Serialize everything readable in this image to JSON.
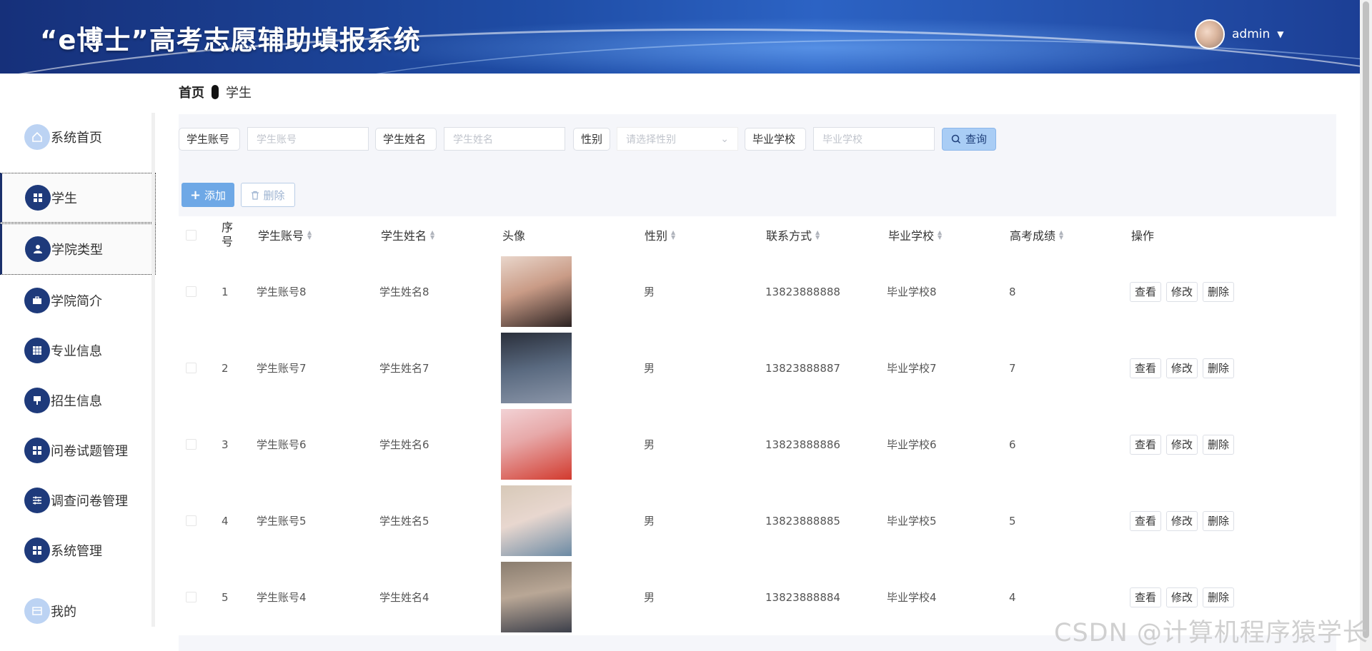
{
  "header": {
    "title": "“e博士”高考志愿辅助填报系统",
    "username": "admin"
  },
  "breadcrumb": {
    "home": "首页",
    "current": "学生"
  },
  "sidebar": {
    "items": [
      {
        "label": "系统首页",
        "icon": "home-icon",
        "active": false
      },
      {
        "label": "学生",
        "icon": "grid-icon",
        "active": true
      },
      {
        "label": "学院类型",
        "icon": "user-icon",
        "active": true
      },
      {
        "label": "学院简介",
        "icon": "briefcase-icon",
        "active": false
      },
      {
        "label": "专业信息",
        "icon": "grid-icon",
        "active": false
      },
      {
        "label": "招生信息",
        "icon": "flag-icon",
        "active": false
      },
      {
        "label": "问卷试题管理",
        "icon": "grid-icon",
        "active": false
      },
      {
        "label": "调查问卷管理",
        "icon": "sliders-icon",
        "active": false
      },
      {
        "label": "系统管理",
        "icon": "grid-icon",
        "active": false
      },
      {
        "label": "我的",
        "icon": "card-icon",
        "active": false
      }
    ]
  },
  "search": {
    "account_label": "学生账号",
    "account_placeholder": "学生账号",
    "name_label": "学生姓名",
    "name_placeholder": "学生姓名",
    "gender_label": "性别",
    "gender_placeholder": "请选择性别",
    "school_label": "毕业学校",
    "school_placeholder": "毕业学校",
    "query_label": "查询"
  },
  "actions": {
    "add_label": "添加",
    "delete_label": "删除"
  },
  "table": {
    "headers": {
      "index": "序号",
      "account": "学生账号",
      "name": "学生姓名",
      "avatar": "头像",
      "gender": "性别",
      "phone": "联系方式",
      "school": "毕业学校",
      "score": "高考成绩",
      "ops": "操作"
    },
    "op_labels": {
      "view": "查看",
      "edit": "修改",
      "delete": "删除"
    },
    "rows": [
      {
        "index": "1",
        "account": "学生账号8",
        "name": "学生姓名8",
        "gender": "男",
        "phone": "13823888888",
        "school": "毕业学校8",
        "score": "8"
      },
      {
        "index": "2",
        "account": "学生账号7",
        "name": "学生姓名7",
        "gender": "男",
        "phone": "13823888887",
        "school": "毕业学校7",
        "score": "7"
      },
      {
        "index": "3",
        "account": "学生账号6",
        "name": "学生姓名6",
        "gender": "男",
        "phone": "13823888886",
        "school": "毕业学校6",
        "score": "6"
      },
      {
        "index": "4",
        "account": "学生账号5",
        "name": "学生姓名5",
        "gender": "男",
        "phone": "13823888885",
        "school": "毕业学校5",
        "score": "5"
      },
      {
        "index": "5",
        "account": "学生账号4",
        "name": "学生姓名4",
        "gender": "男",
        "phone": "13823888884",
        "school": "毕业学校4",
        "score": "4"
      }
    ]
  },
  "watermark": "CSDN @计算机程序猿学长",
  "colors": {
    "header_blue": "#1f4da6",
    "menu_icon": "#1e3a7b",
    "query_button": "#a9cdf5",
    "add_button": "#6ea8e6"
  }
}
